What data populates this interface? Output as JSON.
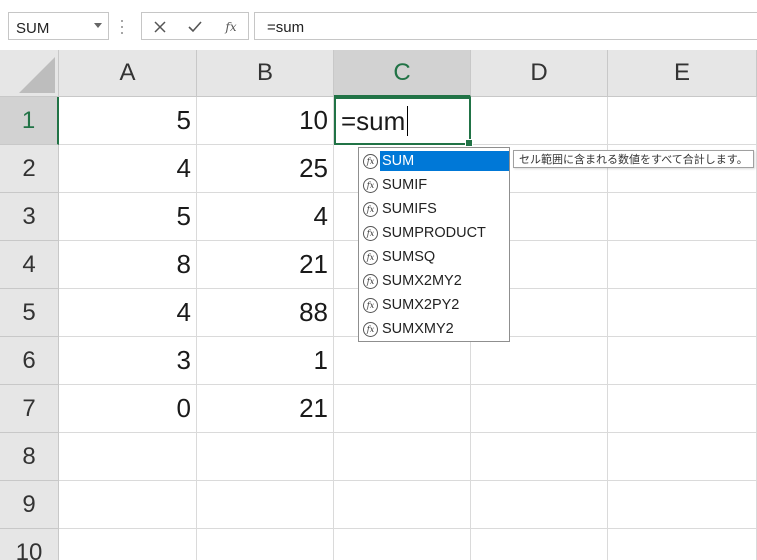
{
  "formula_bar": {
    "name_box": "SUM",
    "formula": "=sum",
    "cancel_icon": "close-icon",
    "enter_icon": "check-icon",
    "fx_label": "fx"
  },
  "columns": [
    "A",
    "B",
    "C",
    "D",
    "E"
  ],
  "active_column": "C",
  "rows": [
    "1",
    "2",
    "3",
    "4",
    "5",
    "6",
    "7",
    "8",
    "9",
    "10"
  ],
  "active_row": "1",
  "cells": {
    "A": [
      "5",
      "4",
      "5",
      "8",
      "4",
      "3",
      "0",
      "",
      "",
      ""
    ],
    "B": [
      "10",
      "25",
      "4",
      "21",
      "88",
      "1",
      "21",
      "",
      "",
      ""
    ],
    "C": [
      "=sum",
      "",
      "",
      "",
      "",
      "",
      "",
      "",
      "",
      ""
    ],
    "D": [
      "",
      "",
      "",
      "",
      "",
      "",
      "",
      "",
      "",
      ""
    ],
    "E": [
      "",
      "",
      "",
      "",
      "",
      "",
      "",
      "",
      "",
      ""
    ]
  },
  "active_cell": "C1",
  "autocomplete": {
    "items": [
      "SUM",
      "SUMIF",
      "SUMIFS",
      "SUMPRODUCT",
      "SUMSQ",
      "SUMX2MY2",
      "SUMX2PY2",
      "SUMXMY2"
    ],
    "selected_index": 0,
    "icon": "function-icon",
    "tooltip": "セル範囲に含まれる数値をすべて合計します。"
  },
  "colors": {
    "accent": "#217346",
    "selection": "#0078d7",
    "header_bg": "#e6e6e6",
    "header_active_bg": "#d2d2d2",
    "gridline": "#dadada"
  }
}
